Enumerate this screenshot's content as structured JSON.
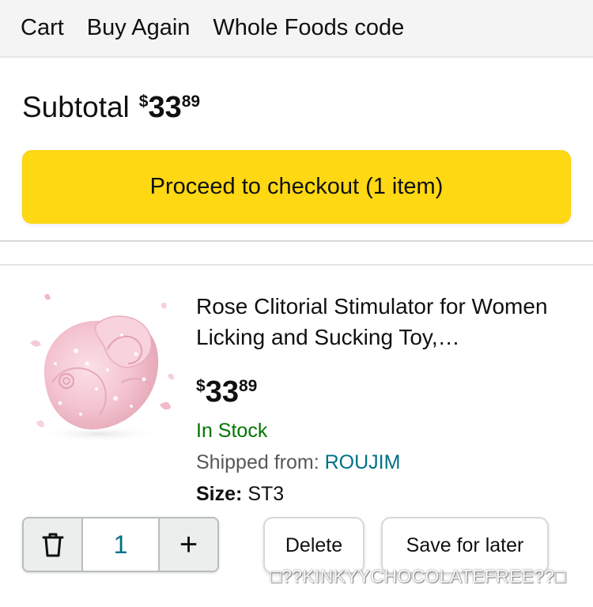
{
  "nav": {
    "items": [
      "Cart",
      "Buy Again",
      "Whole Foods code"
    ]
  },
  "subtotal": {
    "label": "Subtotal",
    "currency": "$",
    "whole": "33",
    "fraction": "89"
  },
  "checkout": {
    "label": "Proceed to checkout (1 item)"
  },
  "cart_item": {
    "title": "Rose Clitorial Stimulator for Women Licking and Sucking Toy,…",
    "price": {
      "currency": "$",
      "whole": "33",
      "fraction": "89"
    },
    "stock": "In Stock",
    "shipped_label": "Shipped from: ",
    "shipped_seller": "ROUJIM",
    "size_key": "Size:",
    "size_value": "ST3",
    "image_icon": "pink-rose-product-image"
  },
  "quantity": {
    "value": "1",
    "decrease_icon": "trash-icon",
    "increase_label": "+"
  },
  "actions": {
    "delete_label": "Delete",
    "save_label": "Save for later"
  },
  "watermark": {
    "text": "□??KINKYYCHOCOLATEFREE??□"
  },
  "colors": {
    "checkout_button": "#ffd814",
    "in_stock": "#007600",
    "link": "#007185"
  }
}
